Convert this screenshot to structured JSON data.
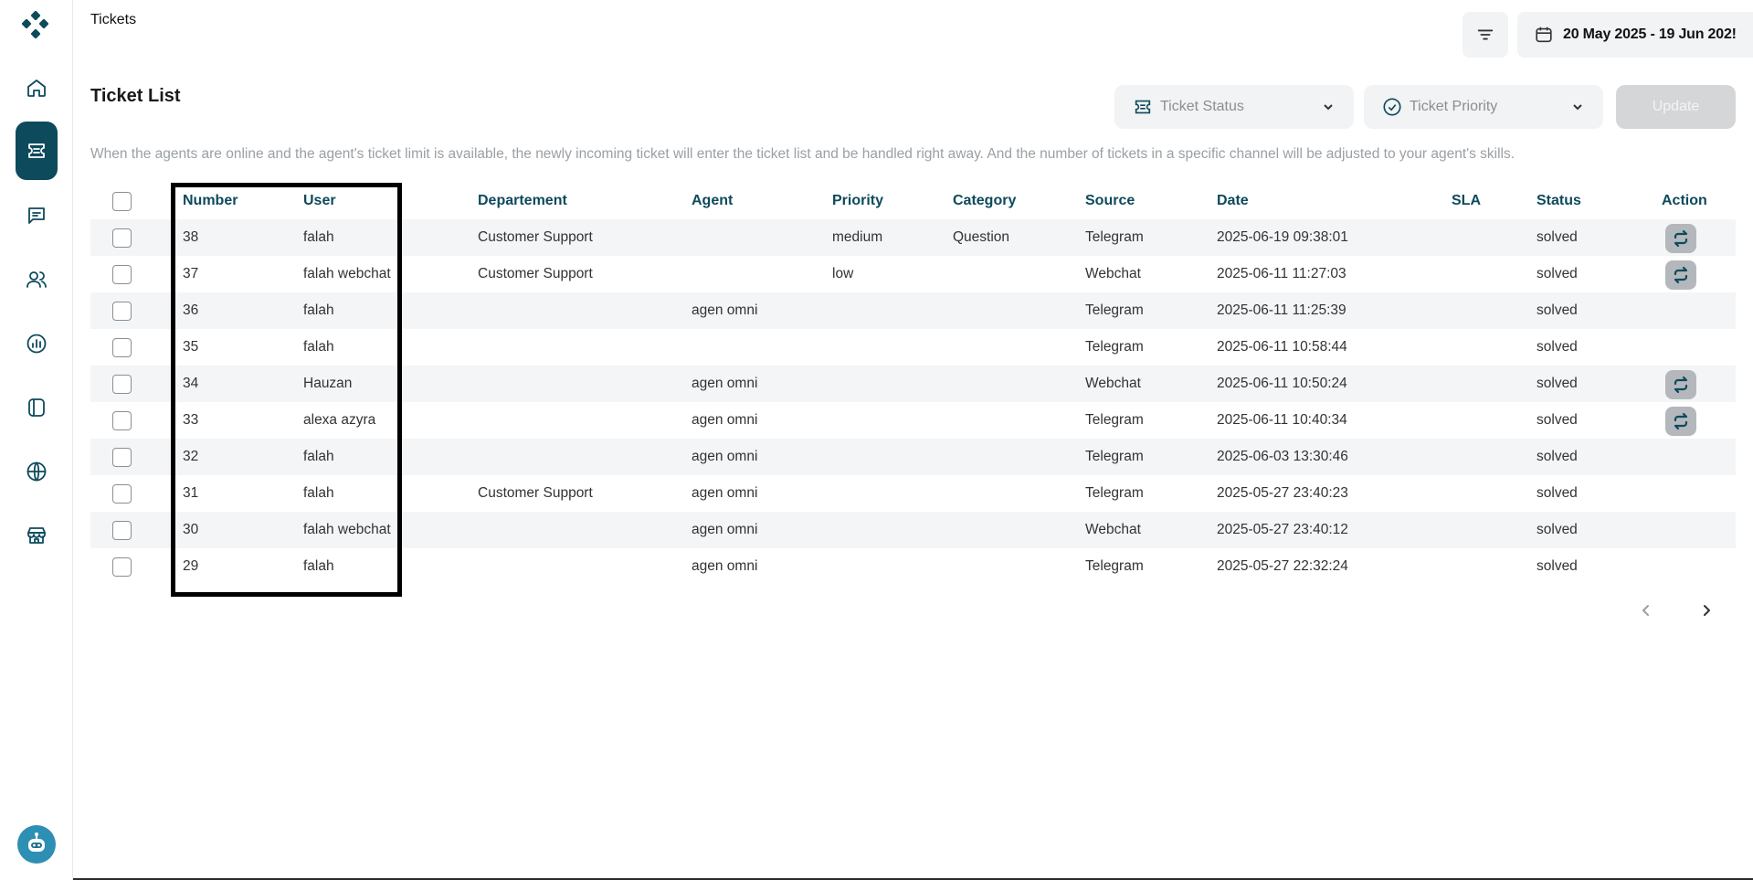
{
  "header": {
    "crumb": "Tickets",
    "date_range": "20 May 2025 - 19 Jun 202!",
    "filter_icon": "filter-lines-icon",
    "calendar_icon": "calendar-icon"
  },
  "sidebar": {
    "items": [
      {
        "name": "home",
        "icon": "home-icon"
      },
      {
        "name": "tickets",
        "icon": "ticket-icon",
        "active": true
      },
      {
        "name": "chat",
        "icon": "chat-bubble-icon"
      },
      {
        "name": "users",
        "icon": "users-icon"
      },
      {
        "name": "reports",
        "icon": "chart-icon"
      },
      {
        "name": "knowledge",
        "icon": "book-icon"
      },
      {
        "name": "channels",
        "icon": "globe-icon"
      },
      {
        "name": "store",
        "icon": "store-icon"
      }
    ],
    "bot_icon": "robot-icon"
  },
  "main": {
    "title": "Ticket List",
    "status_placeholder": "Ticket Status",
    "priority_placeholder": "Ticket Priority",
    "update_label": "Update",
    "description": "When the agents are online and the agent's ticket limit is available, the newly incoming ticket will enter the ticket list and be handled right away. And the number of tickets in a specific channel will be adjusted to your agent's skills."
  },
  "table": {
    "columns": [
      "Number",
      "User",
      "Departement",
      "Agent",
      "Priority",
      "Category",
      "Source",
      "Date",
      "SLA",
      "Status",
      "Action"
    ],
    "rows": [
      {
        "number": "38",
        "user": "falah",
        "department": "Customer Support",
        "agent": "",
        "priority": "medium",
        "category": "Question",
        "source": "Telegram",
        "date": "2025-06-19 09:38:01",
        "sla": "",
        "status": "solved",
        "action": true
      },
      {
        "number": "37",
        "user": "falah webchat",
        "department": "Customer Support",
        "agent": "",
        "priority": "low",
        "category": "",
        "source": "Webchat",
        "date": "2025-06-11 11:27:03",
        "sla": "",
        "status": "solved",
        "action": true
      },
      {
        "number": "36",
        "user": "falah",
        "department": "",
        "agent": "agen omni",
        "priority": "",
        "category": "",
        "source": "Telegram",
        "date": "2025-06-11 11:25:39",
        "sla": "",
        "status": "solved",
        "action": false
      },
      {
        "number": "35",
        "user": "falah",
        "department": "",
        "agent": "",
        "priority": "",
        "category": "",
        "source": "Telegram",
        "date": "2025-06-11 10:58:44",
        "sla": "",
        "status": "solved",
        "action": false
      },
      {
        "number": "34",
        "user": "Hauzan",
        "department": "",
        "agent": "agen omni",
        "priority": "",
        "category": "",
        "source": "Webchat",
        "date": "2025-06-11 10:50:24",
        "sla": "",
        "status": "solved",
        "action": true
      },
      {
        "number": "33",
        "user": "alexa azyra",
        "department": "",
        "agent": "agen omni",
        "priority": "",
        "category": "",
        "source": "Telegram",
        "date": "2025-06-11 10:40:34",
        "sla": "",
        "status": "solved",
        "action": true
      },
      {
        "number": "32",
        "user": "falah",
        "department": "",
        "agent": "agen omni",
        "priority": "",
        "category": "",
        "source": "Telegram",
        "date": "2025-06-03 13:30:46",
        "sla": "",
        "status": "solved",
        "action": false
      },
      {
        "number": "31",
        "user": "falah",
        "department": "Customer Support",
        "agent": "agen omni",
        "priority": "",
        "category": "",
        "source": "Telegram",
        "date": "2025-05-27 23:40:23",
        "sla": "",
        "status": "solved",
        "action": false
      },
      {
        "number": "30",
        "user": "falah webchat",
        "department": "",
        "agent": "agen omni",
        "priority": "",
        "category": "",
        "source": "Webchat",
        "date": "2025-05-27 23:40:12",
        "sla": "",
        "status": "solved",
        "action": false
      },
      {
        "number": "29",
        "user": "falah",
        "department": "",
        "agent": "agen omni",
        "priority": "",
        "category": "",
        "source": "Telegram",
        "date": "2025-05-27 22:32:24",
        "sla": "",
        "status": "solved",
        "action": false
      }
    ],
    "action_icon": "reassign-arrows-icon"
  },
  "pagination": {
    "prev_icon": "chevron-left-icon",
    "next_icon": "chevron-right-icon"
  },
  "colors": {
    "primary": "#0d4a5c",
    "row_alt": "#f4f5f6",
    "muted": "#9aa0a5",
    "button_disabled": "#d4d6d8"
  }
}
